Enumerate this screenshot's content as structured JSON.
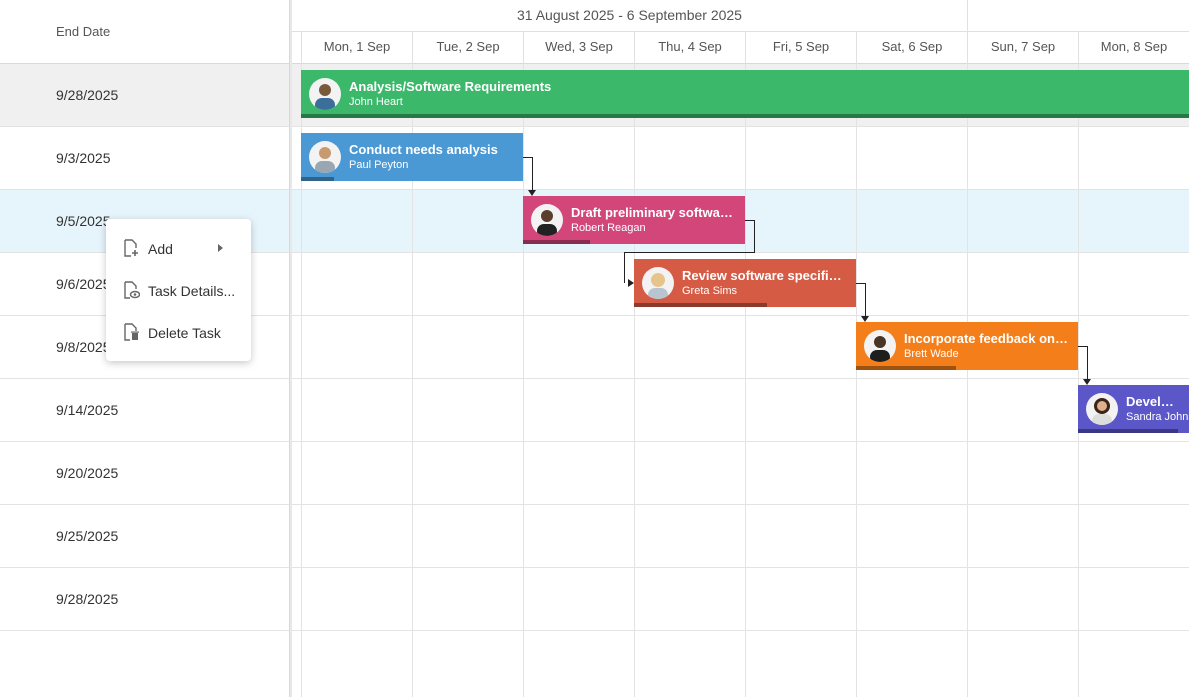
{
  "grid": {
    "column_header": "End Date",
    "rows": [
      {
        "end_date": "9/28/2025"
      },
      {
        "end_date": "9/3/2025"
      },
      {
        "end_date": "9/5/2025"
      },
      {
        "end_date": "9/6/2025"
      },
      {
        "end_date": "9/8/2025"
      },
      {
        "end_date": "9/14/2025"
      },
      {
        "end_date": "9/20/2025"
      },
      {
        "end_date": "9/25/2025"
      },
      {
        "end_date": "9/28/2025"
      }
    ]
  },
  "timeline": {
    "week_label": "31 August 2025 - 6 September 2025",
    "days": [
      "Mon, 1 Sep",
      "Tue, 2 Sep",
      "Wed, 3 Sep",
      "Thu, 4 Sep",
      "Fri, 5 Sep",
      "Sat, 6 Sep",
      "Sun, 7 Sep",
      "Mon, 8 Sep"
    ]
  },
  "tasks": [
    {
      "title": "Analysis/Software Requirements",
      "owner": "John Heart",
      "color": "#3bb86a",
      "progress": 1.0
    },
    {
      "title": "Conduct needs analysis",
      "owner": "Paul Peyton",
      "color": "#4a98d4",
      "progress": 0.15
    },
    {
      "title": "Draft preliminary software ...",
      "owner": "Robert Reagan",
      "color": "#d2467a",
      "progress": 0.3
    },
    {
      "title": "Review software specifica...",
      "owner": "Greta Sims",
      "color": "#d65b44",
      "progress": 0.6
    },
    {
      "title": "Incorporate feedback on s...",
      "owner": "Brett Wade",
      "color": "#f47e19",
      "progress": 0.45
    },
    {
      "title": "Develop de",
      "owner": "Sandra Johns",
      "color": "#5b57c9",
      "progress": 0.9
    }
  ],
  "context_menu": {
    "items": [
      {
        "label": "Add",
        "icon": "add-task-icon",
        "has_submenu": true
      },
      {
        "label": "Task Details...",
        "icon": "task-details-icon",
        "has_submenu": false
      },
      {
        "label": "Delete Task",
        "icon": "delete-task-icon",
        "has_submenu": false
      }
    ]
  }
}
